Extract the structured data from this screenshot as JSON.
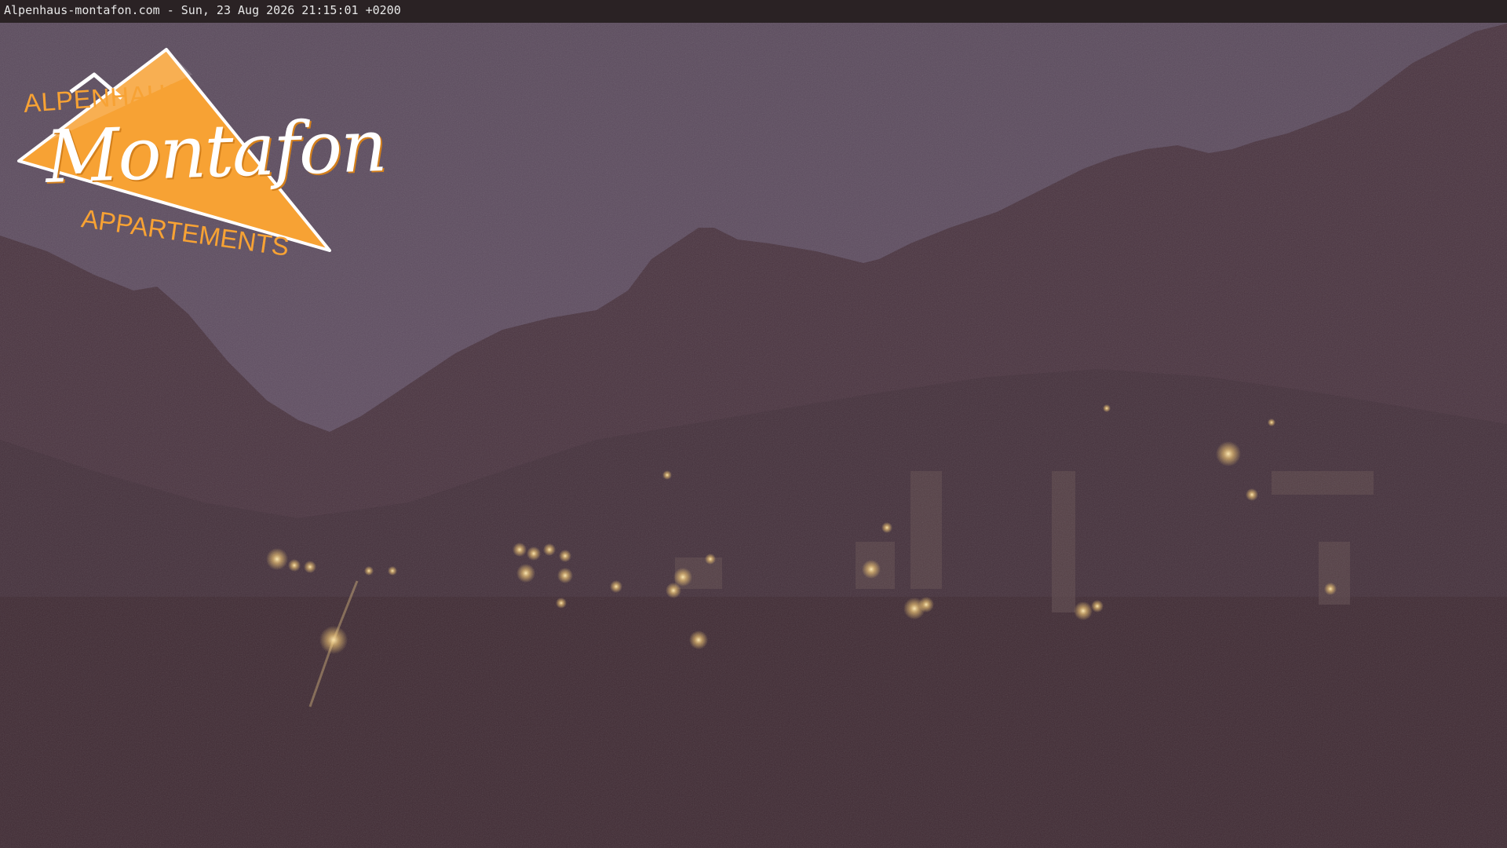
{
  "status_bar": {
    "text": "Alpenhaus-montafon.com - Sun, 23 Aug 2026 21:15:01 +0200"
  },
  "logo": {
    "line_top": "ALPENHAUS",
    "line_main": "Montafon",
    "line_bottom": "APPARTEMENTS",
    "accent_color": "#f7a234"
  },
  "scene": {
    "sky_color": "#5e4a62",
    "mountain_color": "#4a3440",
    "valley_color": "#3f2a33",
    "light_color": "#ffd98a"
  }
}
